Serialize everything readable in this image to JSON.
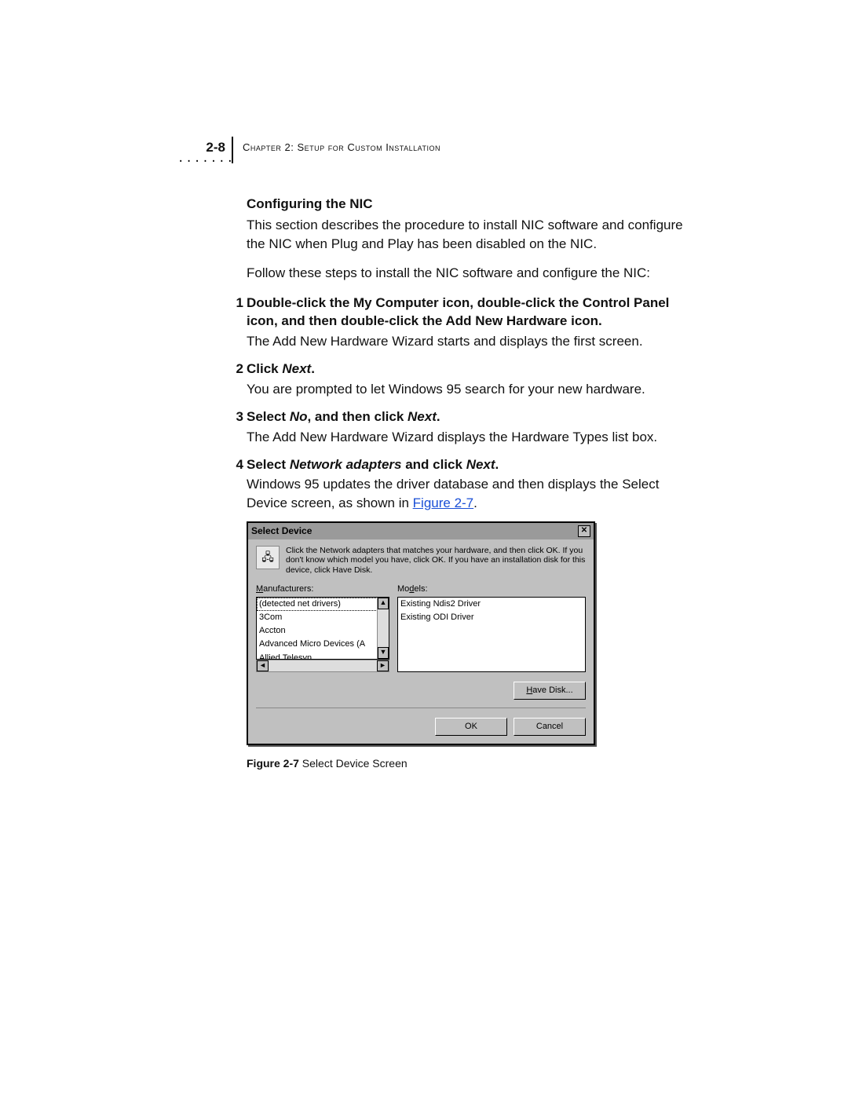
{
  "page_number": "2-8",
  "chapter_label_prefix": "C",
  "chapter_label_rest": "hapter 2: S",
  "chapter_label_rest2": "etup for Custom Installation",
  "chapter_label_full": "Chapter 2: Setup for Custom Installation",
  "section_heading": "Configuring the NIC",
  "intro_para": "This section describes the procedure to install NIC software and configure the NIC when Plug and Play has been disabled on the NIC.",
  "follow_para": "Follow these steps to install the NIC software and configure the NIC:",
  "steps": [
    {
      "num": "1",
      "head_plain": "Double-click the My Computer icon, double-click the Control Panel icon, and then double-click the Add New Hardware icon.",
      "body": "The Add New Hardware Wizard starts and displays the first screen."
    },
    {
      "num": "2",
      "head_pre": "Click ",
      "head_ital": "Next",
      "head_post": ".",
      "body": "You are prompted to let Windows 95 search for your new hardware."
    },
    {
      "num": "3",
      "head_pre": "Select ",
      "head_ital": "No",
      "head_mid": ", and then click ",
      "head_ital2": "Next",
      "head_post": ".",
      "body": "The Add New Hardware Wizard displays the Hardware Types list box."
    },
    {
      "num": "4",
      "head_pre": "Select ",
      "head_ital": "Network adapters",
      "head_mid": " and click ",
      "head_ital2": "Next",
      "head_post": ".",
      "body_pre": "Windows 95 updates the driver database and then displays the Select Device screen, as shown in ",
      "body_link": "Figure 2-7",
      "body_post": "."
    }
  ],
  "dialog": {
    "title": "Select Device",
    "close_glyph": "✕",
    "icon_glyph": "🖧",
    "description": "Click the Network adapters that matches your hardware, and then click OK. If you don't know which model you have, click OK. If you have an installation disk for this device, click Have Disk.",
    "manufacturers_label": "Manufacturers:",
    "models_label": "Models:",
    "manufacturers": [
      "(detected net drivers)",
      "3Com",
      "Accton",
      "Advanced Micro Devices (A",
      "Allied Telesyn"
    ],
    "models": [
      "Existing Ndis2 Driver",
      "Existing ODI Driver"
    ],
    "have_disk_label": "Have Disk...",
    "ok_label": "OK",
    "cancel_label": "Cancel"
  },
  "figure_caption_bold": "Figure 2-7",
  "figure_caption_rest": "   Select Device Screen"
}
